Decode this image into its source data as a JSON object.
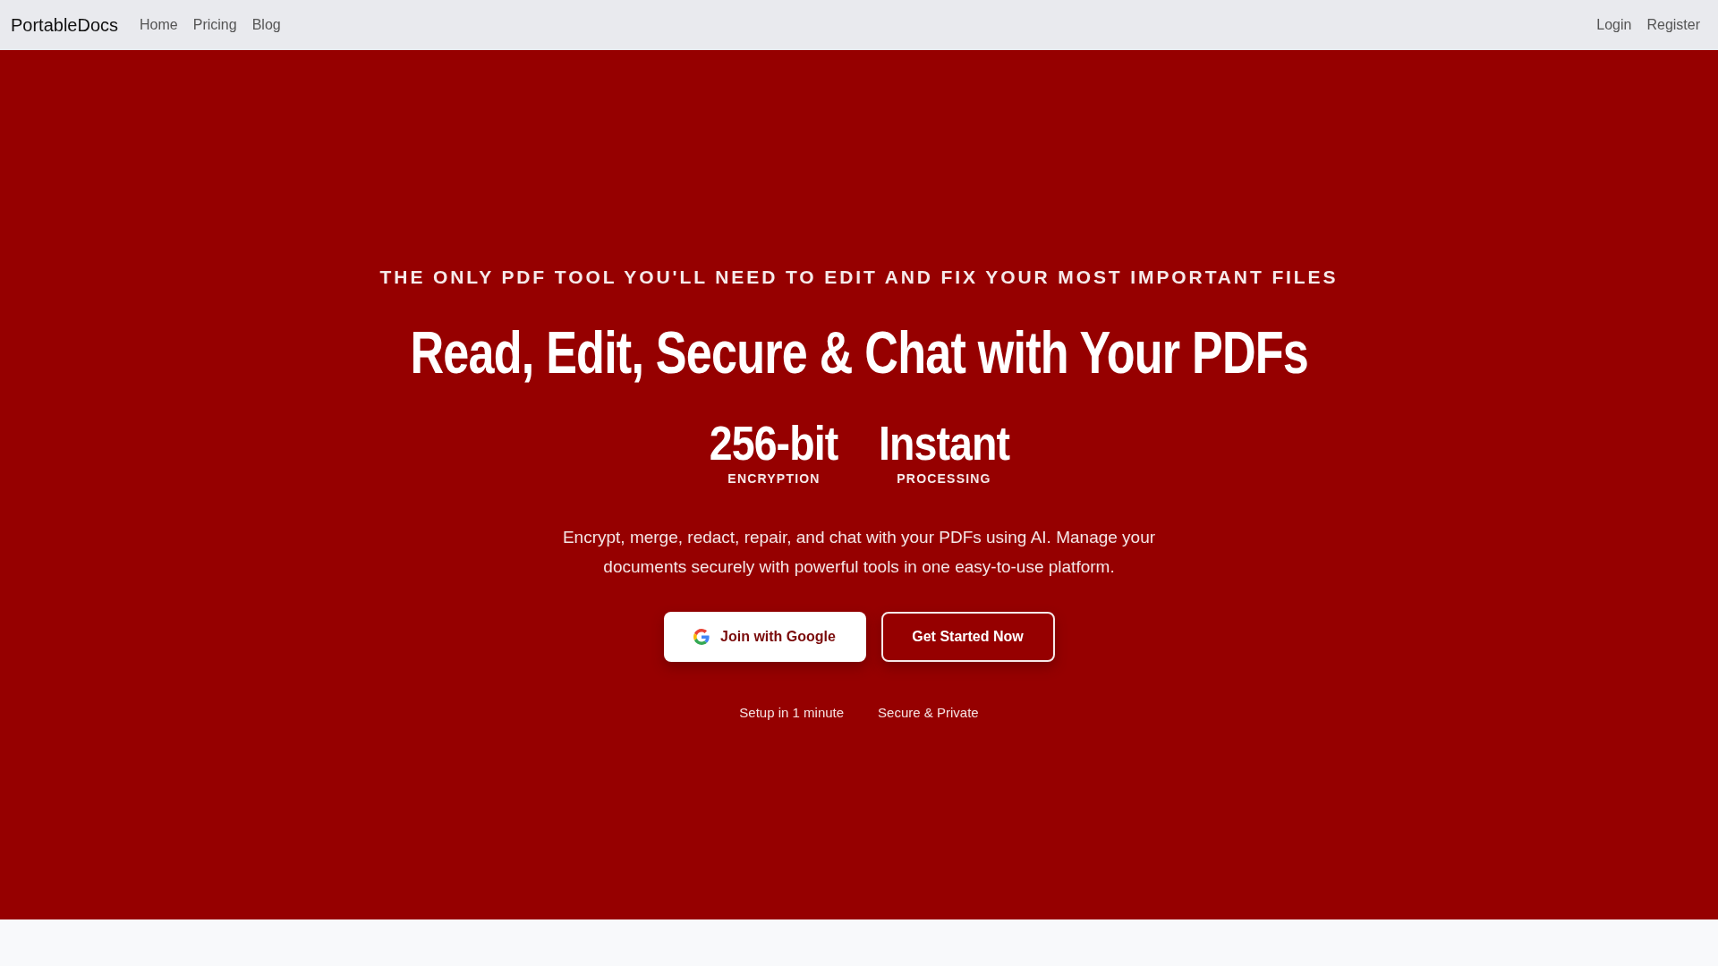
{
  "navbar": {
    "brand": "PortableDocs",
    "links": [
      "Home",
      "Pricing",
      "Blog"
    ],
    "auth_links": [
      "Login",
      "Register"
    ]
  },
  "hero": {
    "eyebrow": "THE ONLY PDF TOOL YOU'LL NEED TO EDIT AND FIX YOUR MOST IMPORTANT FILES",
    "headline": "Read, Edit, Secure & Chat with Your PDFs",
    "stats": [
      {
        "value": "256-bit",
        "label": "ENCRYPTION"
      },
      {
        "value": "Instant",
        "label": "PROCESSING"
      }
    ],
    "description": "Encrypt, merge, redact, repair, and chat with your PDFs using AI. Manage your documents securely with powerful tools in one easy-to-use platform.",
    "buttons": [
      {
        "kind": "google",
        "label": "Join with Google"
      },
      {
        "kind": "outline",
        "label": "Get Started Now"
      }
    ],
    "features": [
      "Setup in 1 minute",
      "Secure & Private"
    ]
  }
}
